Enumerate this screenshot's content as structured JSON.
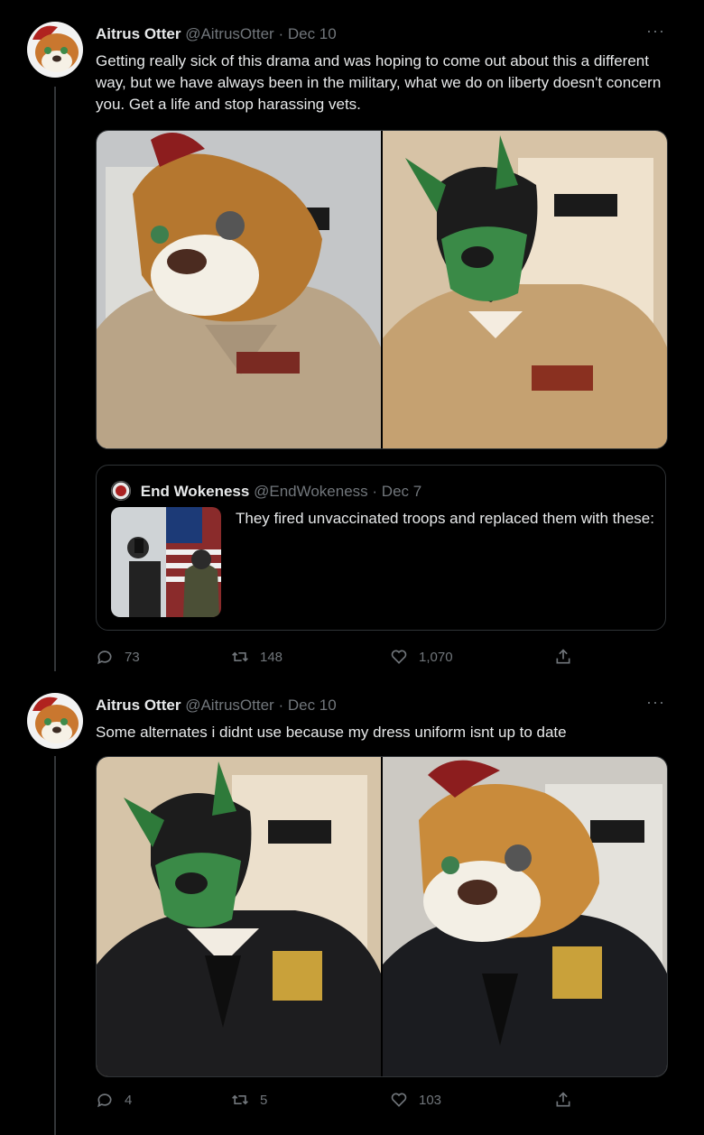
{
  "tweets": [
    {
      "author": {
        "name": "Aitrus Otter",
        "handle": "@AitrusOtter"
      },
      "separator": "·",
      "date": "Dec 10",
      "more": "···",
      "text": "Getting really sick of this drama and was hoping to come out about this a different way, but we have always been in the military, what we do on liberty doesn't concern you. Get a life and stop harassing vets.",
      "media": [
        "Fursuit otter head in khaki service uniform",
        "Green pup hood in khaki service uniform"
      ],
      "quote": {
        "name": "End Wokeness",
        "handle": "@EndWokeness",
        "separator": "·",
        "date": "Dec 7",
        "text": "They fired unvaccinated troops and replaced them with these:"
      },
      "stats": {
        "replies": "73",
        "retweets": "148",
        "likes": "1,070"
      }
    },
    {
      "author": {
        "name": "Aitrus Otter",
        "handle": "@AitrusOtter"
      },
      "separator": "·",
      "date": "Dec 10",
      "more": "···",
      "text": "Some alternates i didnt use because my dress uniform isnt up to date",
      "media": [
        "Green pup hood in dress blue uniform",
        "Fursuit otter head in dress blue uniform"
      ],
      "stats": {
        "replies": "4",
        "retweets": "5",
        "likes": "103"
      }
    }
  ],
  "icons": {
    "reply": "reply-icon",
    "retweet": "retweet-icon",
    "like": "heart-icon",
    "share": "share-icon",
    "more": "more-icon"
  },
  "colors": {
    "background": "#000000",
    "text": "#e7e9ea",
    "secondary": "#71767b",
    "border": "#2f3336"
  }
}
